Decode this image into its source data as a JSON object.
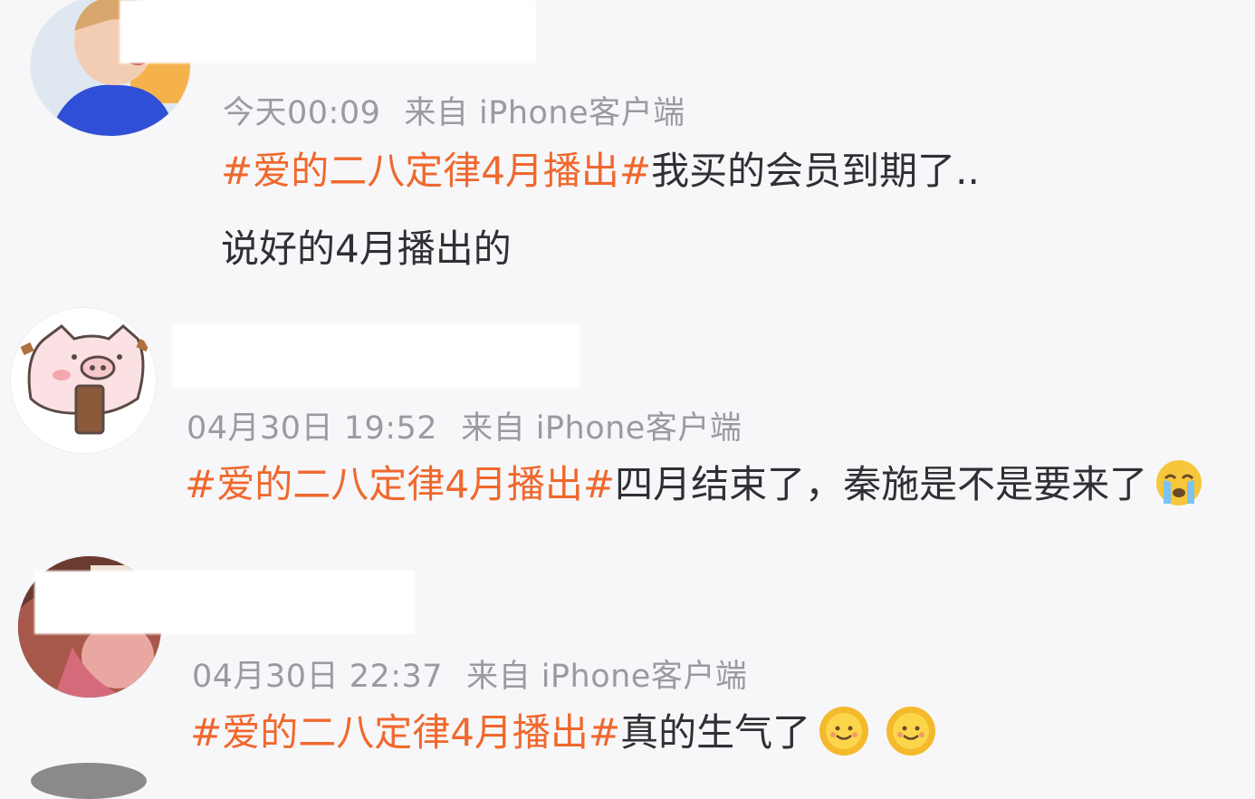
{
  "posts": [
    {
      "time": "今天00:09",
      "source": "来自 iPhone客户端",
      "hashtag": "#爱的二八定律4月播出#",
      "text": "我买的会员到期了..",
      "text2": "说好的4月播出的"
    },
    {
      "time": "04月30日 19:52",
      "source": "来自 iPhone客户端",
      "hashtag": "#爱的二八定律4月播出#",
      "text": "四月结束了，秦施是不是要来了",
      "emojis": [
        "crying-emoji"
      ]
    },
    {
      "time": "04月30日 22:37",
      "source": "来自 iPhone客户端",
      "hashtag": "#爱的二八定律4月播出#",
      "text": "真的生气了",
      "emojis": [
        "sun-smile-emoji",
        "sun-smile-emoji"
      ]
    }
  ],
  "colors": {
    "hashtag": "#f0682e",
    "meta": "#9a9aa2",
    "text": "#2f3033",
    "background": "#f7f7f9"
  }
}
